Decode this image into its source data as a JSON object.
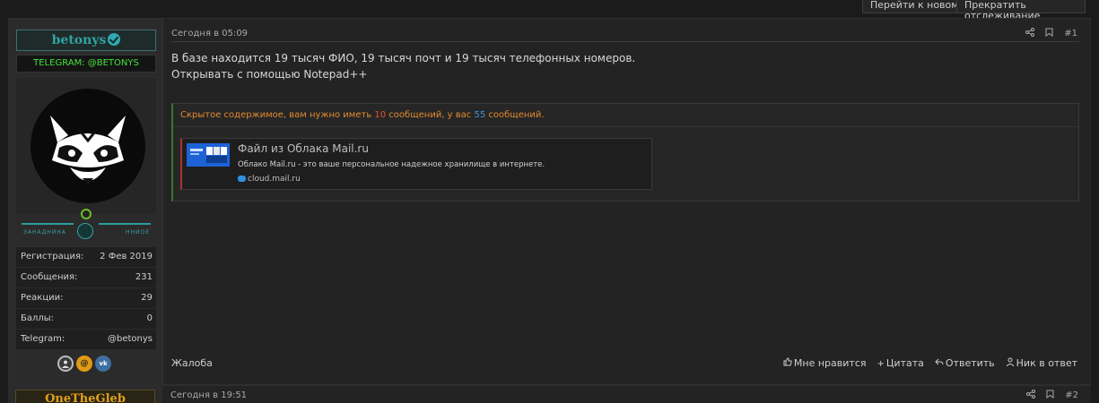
{
  "top_buttons": {
    "goto_new": "Перейти к новому",
    "stop_watching": "Прекратить отслеживание"
  },
  "post1": {
    "author": {
      "username": "betonys",
      "title": "TELEGRAM: @BETONYS",
      "banner_left": "ЗАНАДНИНА",
      "banner_right": "ННИОЕ",
      "stats": [
        {
          "label": "Регистрация:",
          "value": "2 Фев 2019"
        },
        {
          "label": "Сообщения:",
          "value": "231"
        },
        {
          "label": "Реакции:",
          "value": "29"
        },
        {
          "label": "Баллы:",
          "value": "0"
        },
        {
          "label": "Telegram:",
          "value": "@betonys"
        }
      ]
    },
    "date": "Сегодня в 05:09",
    "number": "#1",
    "body": {
      "line1": "В базе находится 19 тысяч ФИО, 19 тысяч почт и 19 тысяч телефонных номеров.",
      "line2": "Открывать с помощью Notepad++"
    },
    "hidden": {
      "prefix": "Скрытое содержимое, вам нужно иметь ",
      "required": "10",
      "middle": " сообщений, у вас ",
      "have": "55",
      "suffix": " сообщений."
    },
    "embed": {
      "title": "Файл из Облака Mail.ru",
      "description": "Облако Mail.ru - это ваше персональное надежное хранилище в интернете.",
      "url": "cloud.mail.ru"
    },
    "complain": "Жалоба",
    "actions": {
      "like": "Мне нравится",
      "quote": "Цитата",
      "reply": "Ответить",
      "nick": "Ник в ответ"
    }
  },
  "post2": {
    "author": {
      "username": "OneTheGleb"
    },
    "date": "Сегодня в 19:51",
    "number": "#2"
  },
  "colors": {
    "accent_teal": "#2fa3a1",
    "warning_orange": "#e38a2f",
    "gold": "#e0a219"
  }
}
